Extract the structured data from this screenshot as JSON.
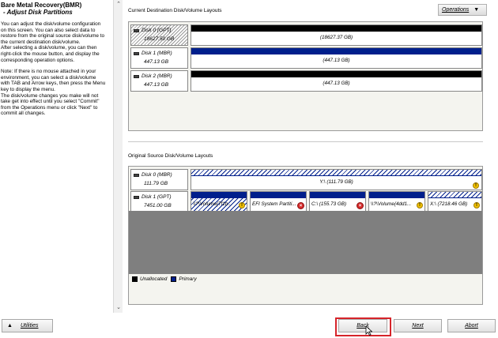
{
  "left_pane": {
    "title": "Bare Metal Recovery(BMR)",
    "subtitle": "- Adjust Disk Partitions",
    "paragraphs": [
      "You can adjust the disk/volume configuration\non this screen. You can also select data to\nrestore from the original source disk/volume to\nthe current destination disk/volume.\nAfter selecting a disk/volume, you can then\nright-click the mouse button, and display the\ncorresponding operation options.",
      "Note: If there is no mouse attached in your\nenvironment, you can select a disk/volume\nwith TAB and Arrow keys, then press the Menu\nkey to display the menu.\nThe disk/volume changes you make will not\ntake get into effect until you select \"Commit\"\nfrom the Operations menu or click \"Next\" to\ncommit all changes."
    ]
  },
  "destination": {
    "label": "Current Destination Disk/Volume Layouts",
    "operations_label": "Operations",
    "disks": [
      {
        "name": "Disk 0 (GPT)",
        "size": "18627.50 GB",
        "partition": "(18627.37 GB)"
      },
      {
        "name": "Disk 1 (MBR)",
        "size": "447.13 GB",
        "partition": "(447.13 GB)"
      },
      {
        "name": "Disk 2 (MBR)",
        "size": "447.13 GB",
        "partition": "(447.13 GB)"
      }
    ]
  },
  "source": {
    "label": "Original Source Disk/Volume Layouts",
    "disk0": {
      "name": "Disk 0 (MBR)",
      "size": "111.79 GB",
      "partition": "Y:\\ (111.79 GB)"
    },
    "disk1": {
      "name": "Disk 1 (GPT)",
      "size": "7451.00 GB",
      "partitions": [
        "\\\\?\\Volume{7f1b...",
        "EFI System Partiti...",
        "C:\\ (155.73 GB)",
        "\\\\?\\Volume{4dd1...",
        "X:\\ (7218.46 GB)"
      ]
    },
    "legend": {
      "unallocated": "Unallocated",
      "primary": "Primary"
    }
  },
  "toolbar": {
    "utilities": "Utilities",
    "back": "Back",
    "next": "Next",
    "abort": "Abort"
  },
  "colors": {
    "unallocated": "#000000",
    "primary": "#001f8c",
    "highlight": "#d6242a",
    "warning": "#f2c200",
    "error": "#d62a2a"
  },
  "icons": [
    "disk-icon",
    "warning-icon",
    "error-icon",
    "chevron-up-icon",
    "chevron-down-icon",
    "caret-down-icon",
    "triangle-up-icon",
    "mouse-cursor-icon"
  ]
}
